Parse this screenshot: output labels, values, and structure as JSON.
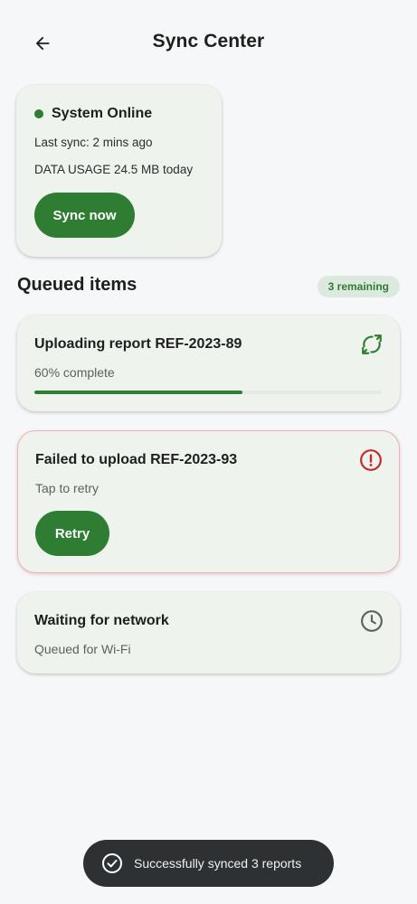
{
  "app_bar": {
    "title": "Sync Center",
    "back_icon": "arrow-back-icon"
  },
  "status": {
    "state": "System Online",
    "state_color": "#2e7d32",
    "last_sync": "Last sync: 2 mins ago",
    "data_usage": "DATA USAGE 24.5 MB today",
    "sync_button_label": "Sync now"
  },
  "queue": {
    "title": "Queued items",
    "remaining_badge": "3 remaining",
    "items": [
      {
        "title": "Uploading report REF-2023-89",
        "subtitle": "60% complete",
        "progress": 0.6,
        "icon": "sync-icon",
        "icon_color": "#2e7d32"
      },
      {
        "title": "Failed to upload REF-2023-93",
        "subtitle": "Tap to retry",
        "action_label": "Retry",
        "icon": "error-icon",
        "icon_color": "#c62828"
      },
      {
        "title": "Waiting for network",
        "subtitle": "Queued for Wi-Fi",
        "icon": "clock-icon",
        "icon_color": "#5c625c"
      }
    ]
  },
  "snackbar": {
    "message": "Successfully synced 3 reports",
    "icon": "check-circle-icon"
  },
  "colors": {
    "accent": "#2e7d32",
    "error": "#c62828",
    "card_bg": "#eef3ee",
    "background": "#f6f7f9"
  }
}
